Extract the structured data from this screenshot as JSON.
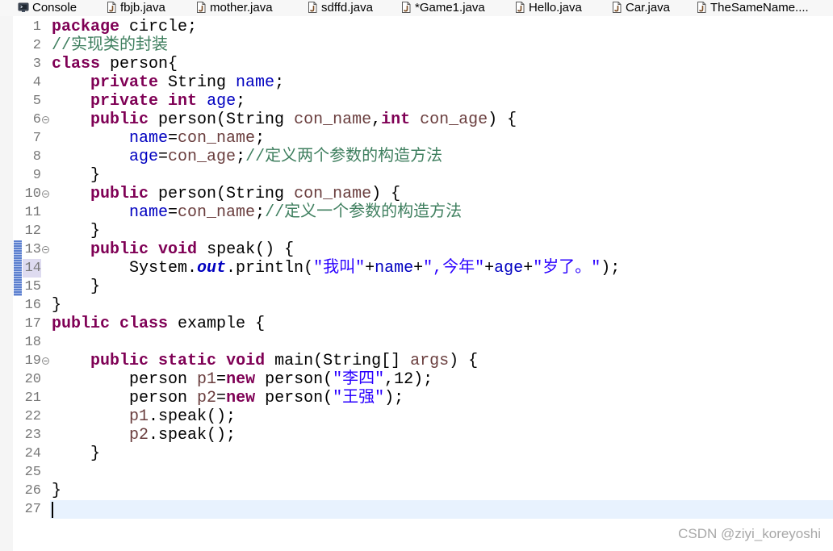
{
  "tabs": [
    {
      "label": "Console",
      "icon": "console-icon"
    },
    {
      "label": "fbjb.java",
      "icon": "java-file-icon"
    },
    {
      "label": "mother.java",
      "icon": "java-file-icon"
    },
    {
      "label": "sdffd.java",
      "icon": "java-file-icon"
    },
    {
      "label": "*Game1.java",
      "icon": "java-file-icon"
    },
    {
      "label": "Hello.java",
      "icon": "java-file-icon"
    },
    {
      "label": "Car.java",
      "icon": "java-file-icon"
    },
    {
      "label": "TheSameName....",
      "icon": "java-file-icon"
    }
  ],
  "editor": {
    "current_line": 27,
    "changed_lines": [
      13,
      14,
      15
    ],
    "marked_line": 14,
    "syntax_colors": {
      "plain": "#000000",
      "keyword": "#7f0055",
      "field": "#0000c0",
      "static_field": "#0000c0",
      "comment": "#3f7f5f",
      "string": "#2a00ff",
      "variable": "#6a3e3e"
    },
    "lines": [
      {
        "n": 1,
        "foldable": false,
        "tokens": [
          {
            "text": "package",
            "kind": "keyword"
          },
          {
            "text": " circle;",
            "kind": "plain"
          }
        ]
      },
      {
        "n": 2,
        "foldable": false,
        "tokens": [
          {
            "text": "//实现类的封装",
            "kind": "comment"
          }
        ]
      },
      {
        "n": 3,
        "foldable": false,
        "tokens": [
          {
            "text": "class",
            "kind": "keyword"
          },
          {
            "text": " person{",
            "kind": "plain"
          }
        ]
      },
      {
        "n": 4,
        "foldable": false,
        "tokens": [
          {
            "text": "    ",
            "kind": "plain"
          },
          {
            "text": "private",
            "kind": "keyword"
          },
          {
            "text": " String ",
            "kind": "plain"
          },
          {
            "text": "name",
            "kind": "field"
          },
          {
            "text": ";",
            "kind": "plain"
          }
        ]
      },
      {
        "n": 5,
        "foldable": false,
        "tokens": [
          {
            "text": "    ",
            "kind": "plain"
          },
          {
            "text": "private",
            "kind": "keyword"
          },
          {
            "text": " ",
            "kind": "plain"
          },
          {
            "text": "int",
            "kind": "keyword"
          },
          {
            "text": " ",
            "kind": "plain"
          },
          {
            "text": "age",
            "kind": "field"
          },
          {
            "text": ";",
            "kind": "plain"
          }
        ]
      },
      {
        "n": 6,
        "foldable": true,
        "tokens": [
          {
            "text": "    ",
            "kind": "plain"
          },
          {
            "text": "public",
            "kind": "keyword"
          },
          {
            "text": " person(String ",
            "kind": "plain"
          },
          {
            "text": "con_name",
            "kind": "variable"
          },
          {
            "text": ",",
            "kind": "plain"
          },
          {
            "text": "int",
            "kind": "keyword"
          },
          {
            "text": " ",
            "kind": "plain"
          },
          {
            "text": "con_age",
            "kind": "variable"
          },
          {
            "text": ") {",
            "kind": "plain"
          }
        ]
      },
      {
        "n": 7,
        "foldable": false,
        "tokens": [
          {
            "text": "        ",
            "kind": "plain"
          },
          {
            "text": "name",
            "kind": "field"
          },
          {
            "text": "=",
            "kind": "plain"
          },
          {
            "text": "con_name",
            "kind": "variable"
          },
          {
            "text": ";",
            "kind": "plain"
          }
        ]
      },
      {
        "n": 8,
        "foldable": false,
        "tokens": [
          {
            "text": "        ",
            "kind": "plain"
          },
          {
            "text": "age",
            "kind": "field"
          },
          {
            "text": "=",
            "kind": "plain"
          },
          {
            "text": "con_age",
            "kind": "variable"
          },
          {
            "text": ";",
            "kind": "plain"
          },
          {
            "text": "//定义两个参数的构造方法",
            "kind": "comment"
          }
        ]
      },
      {
        "n": 9,
        "foldable": false,
        "tokens": [
          {
            "text": "    }",
            "kind": "plain"
          }
        ]
      },
      {
        "n": 10,
        "foldable": true,
        "tokens": [
          {
            "text": "    ",
            "kind": "plain"
          },
          {
            "text": "public",
            "kind": "keyword"
          },
          {
            "text": " person(String ",
            "kind": "plain"
          },
          {
            "text": "con_name",
            "kind": "variable"
          },
          {
            "text": ") {",
            "kind": "plain"
          }
        ]
      },
      {
        "n": 11,
        "foldable": false,
        "tokens": [
          {
            "text": "        ",
            "kind": "plain"
          },
          {
            "text": "name",
            "kind": "field"
          },
          {
            "text": "=",
            "kind": "plain"
          },
          {
            "text": "con_name",
            "kind": "variable"
          },
          {
            "text": ";",
            "kind": "plain"
          },
          {
            "text": "//定义一个参数的构造方法",
            "kind": "comment"
          }
        ]
      },
      {
        "n": 12,
        "foldable": false,
        "tokens": [
          {
            "text": "    }",
            "kind": "plain"
          }
        ]
      },
      {
        "n": 13,
        "foldable": true,
        "tokens": [
          {
            "text": "    ",
            "kind": "plain"
          },
          {
            "text": "public",
            "kind": "keyword"
          },
          {
            "text": " ",
            "kind": "plain"
          },
          {
            "text": "void",
            "kind": "keyword"
          },
          {
            "text": " speak() {",
            "kind": "plain"
          }
        ]
      },
      {
        "n": 14,
        "foldable": false,
        "tokens": [
          {
            "text": "        System.",
            "kind": "plain"
          },
          {
            "text": "out",
            "kind": "static_field"
          },
          {
            "text": ".println(",
            "kind": "plain"
          },
          {
            "text": "\"我叫\"",
            "kind": "string"
          },
          {
            "text": "+",
            "kind": "plain"
          },
          {
            "text": "name",
            "kind": "field"
          },
          {
            "text": "+",
            "kind": "plain"
          },
          {
            "text": "\",今年\"",
            "kind": "string"
          },
          {
            "text": "+",
            "kind": "plain"
          },
          {
            "text": "age",
            "kind": "field"
          },
          {
            "text": "+",
            "kind": "plain"
          },
          {
            "text": "\"岁了。\"",
            "kind": "string"
          },
          {
            "text": ");",
            "kind": "plain"
          }
        ]
      },
      {
        "n": 15,
        "foldable": false,
        "tokens": [
          {
            "text": "    }",
            "kind": "plain"
          }
        ]
      },
      {
        "n": 16,
        "foldable": false,
        "tokens": [
          {
            "text": "}",
            "kind": "plain"
          }
        ]
      },
      {
        "n": 17,
        "foldable": false,
        "tokens": [
          {
            "text": "public",
            "kind": "keyword"
          },
          {
            "text": " ",
            "kind": "plain"
          },
          {
            "text": "class",
            "kind": "keyword"
          },
          {
            "text": " example {",
            "kind": "plain"
          }
        ]
      },
      {
        "n": 18,
        "foldable": false,
        "tokens": []
      },
      {
        "n": 19,
        "foldable": true,
        "tokens": [
          {
            "text": "    ",
            "kind": "plain"
          },
          {
            "text": "public",
            "kind": "keyword"
          },
          {
            "text": " ",
            "kind": "plain"
          },
          {
            "text": "static",
            "kind": "keyword"
          },
          {
            "text": " ",
            "kind": "plain"
          },
          {
            "text": "void",
            "kind": "keyword"
          },
          {
            "text": " main(String[] ",
            "kind": "plain"
          },
          {
            "text": "args",
            "kind": "variable"
          },
          {
            "text": ") {",
            "kind": "plain"
          }
        ]
      },
      {
        "n": 20,
        "foldable": false,
        "tokens": [
          {
            "text": "        person ",
            "kind": "plain"
          },
          {
            "text": "p1",
            "kind": "variable"
          },
          {
            "text": "=",
            "kind": "plain"
          },
          {
            "text": "new",
            "kind": "keyword"
          },
          {
            "text": " person(",
            "kind": "plain"
          },
          {
            "text": "\"李四\"",
            "kind": "string"
          },
          {
            "text": ",12);",
            "kind": "plain"
          }
        ]
      },
      {
        "n": 21,
        "foldable": false,
        "tokens": [
          {
            "text": "        person ",
            "kind": "plain"
          },
          {
            "text": "p2",
            "kind": "variable"
          },
          {
            "text": "=",
            "kind": "plain"
          },
          {
            "text": "new",
            "kind": "keyword"
          },
          {
            "text": " person(",
            "kind": "plain"
          },
          {
            "text": "\"王强\"",
            "kind": "string"
          },
          {
            "text": ");",
            "kind": "plain"
          }
        ]
      },
      {
        "n": 22,
        "foldable": false,
        "tokens": [
          {
            "text": "        ",
            "kind": "plain"
          },
          {
            "text": "p1",
            "kind": "variable"
          },
          {
            "text": ".speak();",
            "kind": "plain"
          }
        ]
      },
      {
        "n": 23,
        "foldable": false,
        "tokens": [
          {
            "text": "        ",
            "kind": "plain"
          },
          {
            "text": "p2",
            "kind": "variable"
          },
          {
            "text": ".speak();",
            "kind": "plain"
          }
        ]
      },
      {
        "n": 24,
        "foldable": false,
        "tokens": [
          {
            "text": "    }",
            "kind": "plain"
          }
        ]
      },
      {
        "n": 25,
        "foldable": false,
        "tokens": []
      },
      {
        "n": 26,
        "foldable": false,
        "tokens": [
          {
            "text": "}",
            "kind": "plain"
          }
        ]
      },
      {
        "n": 27,
        "foldable": false,
        "tokens": []
      }
    ]
  },
  "watermark": "CSDN @ziyi_koreyoshi"
}
